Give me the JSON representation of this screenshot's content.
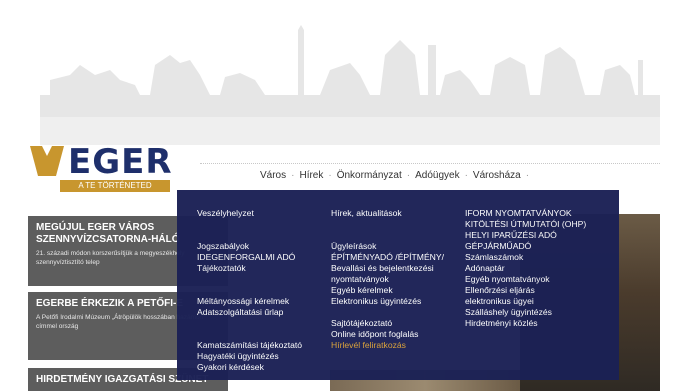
{
  "logo": {
    "name": "EGER",
    "tagline": "A TE TÖRTÉNETED"
  },
  "topnav": {
    "items": [
      "Város",
      "Hírek",
      "Önkormányzat",
      "Adóügyek",
      "Városháza"
    ],
    "separator": "·"
  },
  "news": [
    {
      "title": "MEGÚJUL EGER VÁROS SZENNYVÍZCSATORNA-HÁLÓ",
      "desc": "21. századi módon korszerűsítjük a megyeszékhely szennyvíztisztító telep"
    },
    {
      "title": "EGERBE ÉRKEZIK A PETŐFI-E",
      "desc": "A Petőfi Irodalmi Múzeum „Átröpülök hosszában hazámon” címmel ország"
    },
    {
      "title": "HIRDETMÉNY IGAZGATÁSI SZÜNET"
    }
  ],
  "menu": {
    "col1": {
      "group1": [
        "Veszélyhelyzet"
      ],
      "group2": [
        "Jogszabályok",
        "IDEGENFORGALMI ADÓ",
        "Tájékoztatók"
      ],
      "group3": [
        "Méltányossági kérelmek",
        "Adatszolgáltatási űrlap"
      ],
      "group4": [
        "Kamatszámítási tájékoztató",
        "Hagyatéki ügyintézés",
        "Gyakori kérdések"
      ]
    },
    "col2": {
      "group1": [
        "Hírek, aktualitások"
      ],
      "group2": [
        "Ügyleírások",
        "ÉPÍTMÉNYADÓ /ÉPÍTMÉNY/",
        "Bevallási és bejelentkezési",
        "nyomtatványok",
        "Egyéb kérelmek",
        "Elektronikus ügyintézés"
      ],
      "group3": [
        "Sajtótájékoztató",
        "Online időpont foglalás",
        "Hírlevél feliratkozás"
      ]
    },
    "col3": {
      "items": [
        "IFORM NYOMTATVÁNYOK",
        "KITÖLTÉSI ÚTMUTATÓI (OHP)",
        "HELYI IPARŰZÉSI ADÓ",
        "GÉPJÁRMŰADÓ",
        "Számlaszámok",
        "Adónaptár",
        "Egyéb nyomtatványok",
        "Ellenőrzési eljárás",
        "elektronikus ügyei",
        "Szálláshely ügyintézés",
        "Hirdetményi közlés"
      ]
    },
    "highlight_color": "#d9a036",
    "background_color": "#1b2155"
  },
  "colors": {
    "brand_navy": "#1e2f6b",
    "brand_gold": "#c8962e"
  }
}
